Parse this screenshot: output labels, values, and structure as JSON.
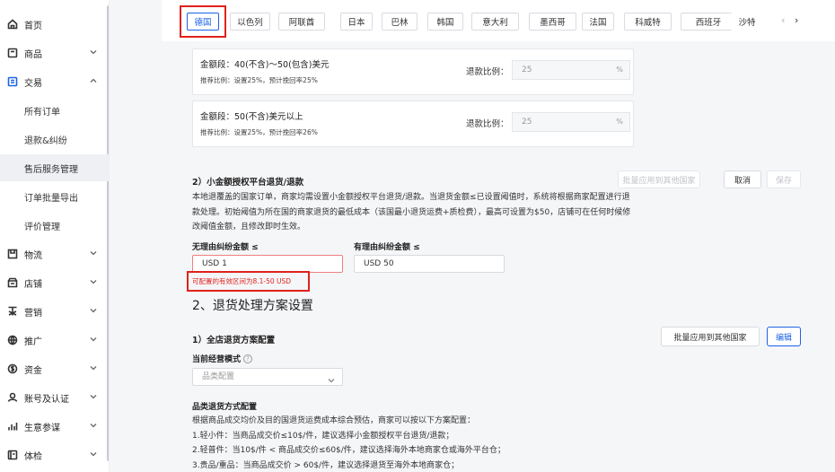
{
  "sidebar": {
    "items": [
      {
        "label": "首页",
        "icon": "home-icon",
        "expandable": false
      },
      {
        "label": "商品",
        "icon": "product-icon",
        "expandable": true
      },
      {
        "label": "交易",
        "icon": "transaction-icon",
        "expandable": true,
        "expanded": true
      },
      {
        "label": "物流",
        "icon": "logistics-icon",
        "expandable": true
      },
      {
        "label": "店铺",
        "icon": "store-icon",
        "expandable": true
      },
      {
        "label": "营销",
        "icon": "marketing-icon",
        "expandable": true
      },
      {
        "label": "推广",
        "icon": "promotion-icon",
        "expandable": true
      },
      {
        "label": "资金",
        "icon": "funds-icon",
        "expandable": true
      },
      {
        "label": "账号及认证",
        "icon": "account-icon",
        "expandable": true
      },
      {
        "label": "生意参谋",
        "icon": "analytics-icon",
        "expandable": true
      },
      {
        "label": "体检",
        "icon": "checkup-icon",
        "expandable": true
      }
    ],
    "sub_items": [
      "所有订单",
      "退款&纠纷",
      "售后服务管理",
      "订单批量导出",
      "评价管理"
    ],
    "active_sub": "售后服务管理"
  },
  "countries": [
    "德国",
    "以色列",
    "阿联酋",
    "日本",
    "巴林",
    "韩国",
    "意大利",
    "墨西哥",
    "法国",
    "科威特",
    "西班牙",
    "沙特"
  ],
  "selected_country": "德国",
  "tiers": [
    {
      "range": "金额段：40(不含)～50(包含)美元",
      "hint": "推荐比例：设置25%，预计挽回率25%",
      "ratio_label": "退款比例：",
      "ratio_value": "25",
      "unit": "%"
    },
    {
      "range": "金额段：50(不含)美元以上",
      "hint": "推荐比例：设置25%，预计挽回率26%",
      "ratio_label": "退款比例：",
      "ratio_value": "25",
      "unit": "%"
    }
  ],
  "small_amount": {
    "title": "2）小金额授权平台退货/退款",
    "batch_label": "批量应用到其他国家",
    "cancel_label": "取消",
    "save_label": "保存",
    "desc": [
      "本地退覆盖的国家订单，商家均需设置小金额授权平台退货/退款。当退货金额≤已设置阈值时，系统将根据商家配置进行退",
      "款处理。初始阈值为所在国的商家退货的最低成本（该国最小退货运费+质检费），最高可设置为$50，店铺可在任何时候修",
      "改阈值金额，且修改即时生效。"
    ],
    "no_reason_label": "无理由纠纷金额 ≤",
    "no_reason_value": "USD   1",
    "reason_label": "有理由纠纷金额 ≤",
    "reason_value": "USD   50",
    "error": "可配置的有效区间为8.1-50 USD"
  },
  "return_plan": {
    "heading": "2、退货处理方案设置",
    "title": "1）全店退货方案配置",
    "batch_label": "批量应用到其他国家",
    "edit_label": "编辑",
    "mode_label": "当前经营模式",
    "mode_value": "品类配置",
    "config_title": "品类退货方式配置",
    "lines": [
      "根据商品成交均价及目的国退货运费成本综合预估，商家可以按以下方案配置：",
      "1.轻小件：当商品成交价≤10$/件，建议选择小金额授权平台退货/退款；",
      "2.轻普件：当10$/件 < 商品成交价≤60$/件，建议选择海外本地商家仓或海外平台仓；",
      "3.贵品/重品：当商品成交价 > 60$/件，建议选择退货至海外本地商家仓；"
    ]
  },
  "colors": {
    "accent": "#1a63e8",
    "error": "#e0221c"
  }
}
